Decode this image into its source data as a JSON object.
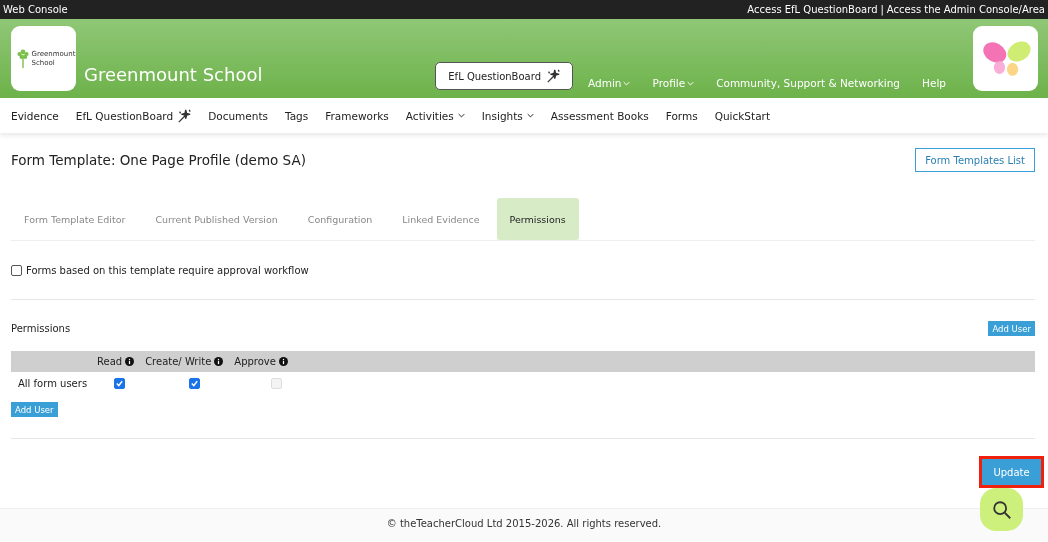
{
  "top_bar": {
    "title": "Web Console",
    "links": [
      {
        "label": "Access EfL QuestionBoard"
      },
      {
        "label": "Access the Admin Console/Area"
      }
    ],
    "separator": "|"
  },
  "header": {
    "school_name": "Greenmount School",
    "logo_caption": "Greenmount School",
    "questionboard_button": "EfL QuestionBoard",
    "menu": [
      {
        "label": "Admin",
        "dropdown": true
      },
      {
        "label": "Profile",
        "dropdown": true
      },
      {
        "label": "Community, Support & Networking",
        "dropdown": false
      },
      {
        "label": "Help",
        "dropdown": false
      }
    ]
  },
  "nav": [
    {
      "label": "Evidence",
      "dropdown": false,
      "wand": false
    },
    {
      "label": "EfL QuestionBoard",
      "dropdown": false,
      "wand": true
    },
    {
      "label": "Documents",
      "dropdown": false,
      "wand": false
    },
    {
      "label": "Tags",
      "dropdown": false,
      "wand": false
    },
    {
      "label": "Frameworks",
      "dropdown": false,
      "wand": false
    },
    {
      "label": "Activities",
      "dropdown": true,
      "wand": false
    },
    {
      "label": "Insights",
      "dropdown": true,
      "wand": false
    },
    {
      "label": "Assessment Books",
      "dropdown": false,
      "wand": false
    },
    {
      "label": "Forms",
      "dropdown": false,
      "wand": false
    },
    {
      "label": "QuickStart",
      "dropdown": false,
      "wand": false
    }
  ],
  "page": {
    "title": "Form Template: One Page Profile (demo SA)",
    "list_button": "Form Templates List"
  },
  "tabs": [
    {
      "label": "Form Template Editor",
      "selected": false
    },
    {
      "label": "Current Published Version",
      "selected": false
    },
    {
      "label": "Configuration",
      "selected": false
    },
    {
      "label": "Linked Evidence",
      "selected": false
    },
    {
      "label": "Permissions",
      "selected": true
    }
  ],
  "approval_workflow": {
    "label": "Forms based on this template require approval workflow",
    "checked": false
  },
  "permissions": {
    "title": "Permissions",
    "add_user_top": "Add User",
    "columns": [
      "Read",
      "Create/ Write",
      "Approve"
    ],
    "rows": [
      {
        "name": "All form users",
        "cells": [
          {
            "checked": true,
            "disabled": false
          },
          {
            "checked": true,
            "disabled": false
          },
          {
            "checked": false,
            "disabled": true
          }
        ]
      }
    ],
    "add_user_bottom": "Add User"
  },
  "update_button": {
    "label": "Update",
    "highlighted": true
  },
  "footer": "© theTeacherCloud Ltd 2015-2026. All rights reserved."
}
